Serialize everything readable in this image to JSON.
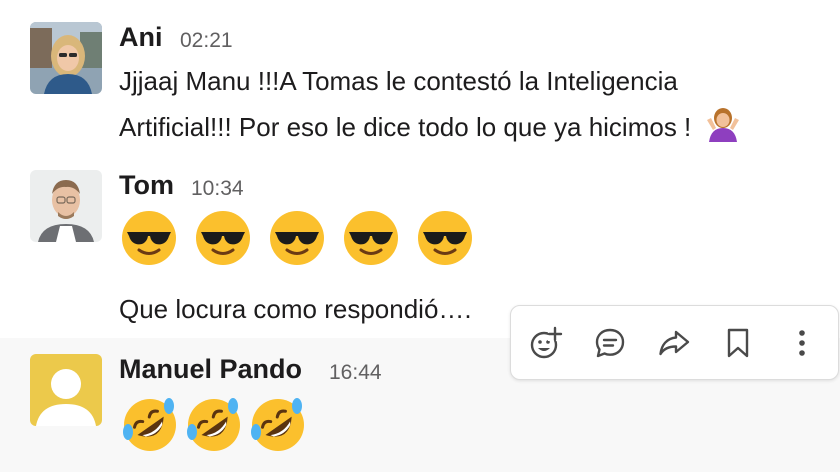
{
  "messages": [
    {
      "author": "Ani",
      "time": "02:21",
      "lines": [
        "Jjjaaj Manu !!!A Tomas le contestó la Inteligencia",
        "Artificial!!! Por eso le dice todo lo que ya hicimos !"
      ],
      "trailing_emoji": "person-shrugging-icon"
    },
    {
      "author": "Tom",
      "time": "10:34",
      "emoji_count": 5,
      "emoji": "smiling-face-with-sunglasses-icon",
      "text": "Que locura como respondió…."
    },
    {
      "author": "Manuel Pando",
      "time": "16:44",
      "emoji_count": 3,
      "emoji": "rolling-on-floor-laughing-icon"
    }
  ],
  "toolbar": {
    "actions": [
      "add-reaction-icon",
      "reply-in-thread-icon",
      "share-icon",
      "save-bookmark-icon",
      "more-actions-icon"
    ]
  },
  "colors": {
    "text": "#1d1c1d",
    "timestamp": "#616061",
    "hover_background": "#f8f8f8",
    "default_avatar": "#ecc94b",
    "emoji_yellow": "#fbc02d"
  }
}
